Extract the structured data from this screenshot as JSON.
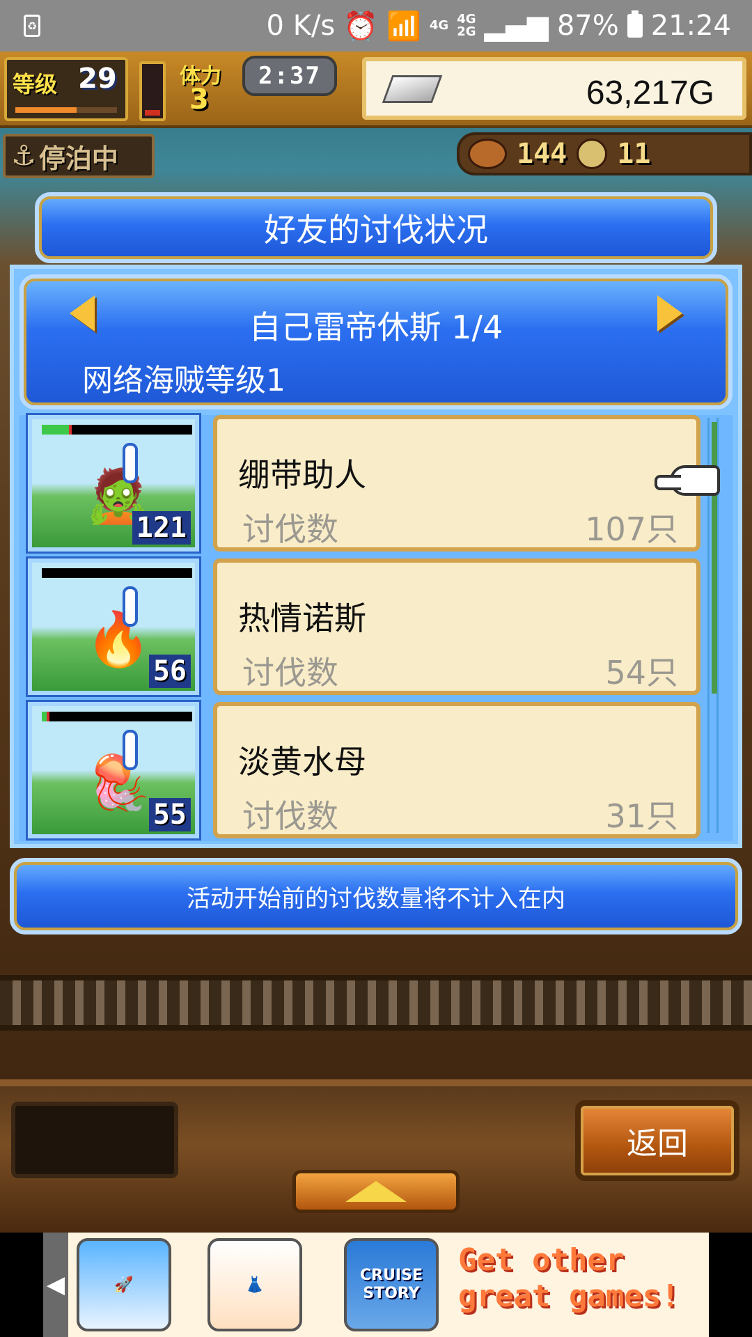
{
  "status_bar": {
    "speed": "0 K/s",
    "network_top": "4G",
    "network_dual": "4G",
    "network_dual_bottom": "2G",
    "battery": "87%",
    "time": "21:24"
  },
  "hud": {
    "level_label": "等级",
    "level_value": "29",
    "level_progress": 0.6,
    "stamina_label": "体力",
    "stamina_value": "3",
    "stamina_fill": 0.1,
    "timer": "2:37",
    "gold": "63,217G",
    "dock_status": "停泊中",
    "resource_food": "144",
    "resource_coin": "11"
  },
  "dialog": {
    "title": "好友的讨伐状况",
    "player_name": "自己雷帝休斯 1/4",
    "player_rank": "网络海贼等级1",
    "footer_note": "活动开始前的讨伐数量将不计入在内"
  },
  "monsters": [
    {
      "name": "绷带助人",
      "kill_label": "讨伐数",
      "kill_count": "107只",
      "level": "121",
      "hp": 0.2,
      "sprite": "🧟"
    },
    {
      "name": "热情诺斯",
      "kill_label": "讨伐数",
      "kill_count": "54只",
      "level": "56",
      "hp": 0.0,
      "sprite": "🔥"
    },
    {
      "name": "淡黄水母",
      "kill_label": "讨伐数",
      "kill_count": "31只",
      "level": "55",
      "hp": 0.05,
      "sprite": "🪼"
    }
  ],
  "controls": {
    "back_label": "返回"
  },
  "ad": {
    "tile3_text": "CRUISE STORY",
    "headline": "Get other great games!"
  },
  "colors": {
    "dialog_blue": "#2b6ff0",
    "card_cream": "#f9ecc8",
    "gold_trim": "#c9a242"
  }
}
